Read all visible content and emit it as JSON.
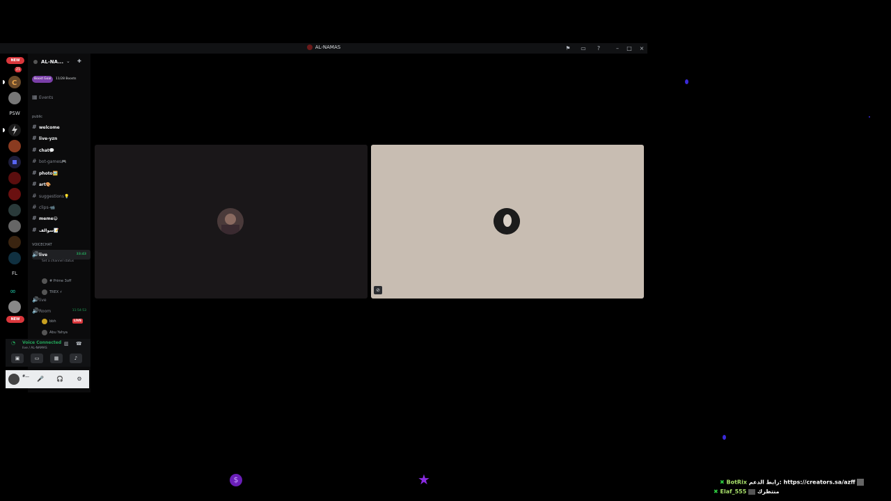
{
  "window": {
    "title": "AL-NAMAS",
    "titlebar_icons": [
      "flag-icon",
      "inbox-icon",
      "help-icon",
      "minimize-icon",
      "maximize-icon",
      "close-icon"
    ]
  },
  "guilds": {
    "new_badge_top": "NEW",
    "mention_count": "21",
    "psw_label": "PSW",
    "fl_label": "FL",
    "new_badge_bottom": "NEW"
  },
  "server": {
    "name": "AL-NA...",
    "boost_goal_label": "Boost Goal",
    "boost_progress": "11/28 Boosts",
    "events_label": "Events",
    "public_category": "public",
    "text_channels": [
      {
        "name": "welcome",
        "style": "bright"
      },
      {
        "name": "live-yzn",
        "style": "bright"
      },
      {
        "name": "chat💬",
        "style": "bright"
      },
      {
        "name": "bot-games🎮",
        "style": "muted"
      },
      {
        "name": "photo🖼️",
        "style": "bright"
      },
      {
        "name": "art🎨",
        "style": "bright"
      },
      {
        "name": "suggestions💡",
        "style": "muted"
      },
      {
        "name": "clips-📹",
        "style": "muted"
      },
      {
        "name": "meme😄",
        "style": "bright"
      },
      {
        "name": "سوالف📝",
        "style": "bright"
      }
    ],
    "voice_category": "VOICECHAT",
    "voice_channels": [
      {
        "name": "live",
        "timer": "33:43",
        "status": "Set a channel status",
        "users": [
          "# Prime 3off",
          "TREX ⚡"
        ]
      },
      {
        "name": "live",
        "timer": "",
        "status": "",
        "users": []
      },
      {
        "name": "Room",
        "timer": "11:54:53",
        "status": "",
        "users": [
          "bbh",
          "Abu Yahya"
        ]
      }
    ],
    "live_badge": "LIVE"
  },
  "voice_panel": {
    "status": "Voice Connected",
    "location": "live / AL-NAMAS"
  },
  "user_panel": {
    "username": "#..."
  },
  "overlay_chat": [
    {
      "name": "BotRix",
      "text": "رابط الدعم: https://creators.sa/azff"
    },
    {
      "name": "Elaf_555",
      "text": "منتظرك"
    }
  ],
  "colors": {
    "accent_purple": "#8a2be2",
    "live_red": "#da373c",
    "voice_green": "#23a55a",
    "tile_right_bg": "#c8bdb2"
  }
}
